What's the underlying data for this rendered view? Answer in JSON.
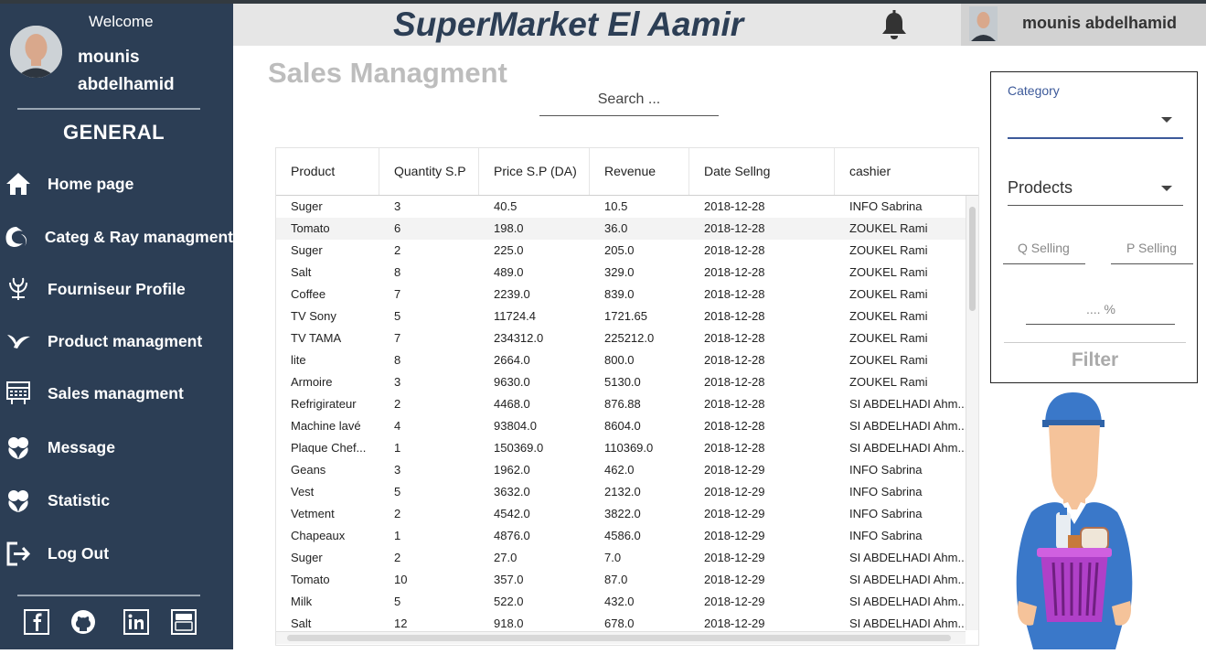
{
  "sidebar": {
    "welcome": "Welcome",
    "user_name": "mounis abdelhamid",
    "section": "GENERAL",
    "nav": [
      {
        "label": "Home page",
        "icon": "home-icon"
      },
      {
        "label": "Categ & Ray managment",
        "icon": "categ-icon"
      },
      {
        "label": "Fourniseur Profile",
        "icon": "fournisseur-icon"
      },
      {
        "label": "Product managment",
        "icon": "product-icon"
      },
      {
        "label": "Sales managment",
        "icon": "sales-icon"
      },
      {
        "label": "Message",
        "icon": "message-icon"
      },
      {
        "label": "Statistic",
        "icon": "statistic-icon"
      },
      {
        "label": "Log Out",
        "icon": "logout-icon"
      }
    ],
    "social": [
      "facebook-icon",
      "github-icon",
      "linkedin-icon",
      "youtube-icon"
    ]
  },
  "header": {
    "app_title": "SuperMarket El Aamir",
    "user_name": "mounis  abdelhamid"
  },
  "main": {
    "page_title": "Sales Managment",
    "search_placeholder": "Search ..."
  },
  "table": {
    "columns": [
      "Product",
      "Quantity S.P",
      "Price S.P (DA)",
      "Revenue",
      "Date Sellng",
      "cashier"
    ],
    "rows": [
      [
        "Suger",
        "3",
        "40.5",
        "10.5",
        "2018-12-28",
        "INFO Sabrina"
      ],
      [
        "Tomato",
        "6",
        "198.0",
        "36.0",
        "2018-12-28",
        "ZOUKEL Rami"
      ],
      [
        "Suger",
        "2",
        "225.0",
        "205.0",
        "2018-12-28",
        "ZOUKEL Rami"
      ],
      [
        "Salt",
        "8",
        "489.0",
        "329.0",
        "2018-12-28",
        "ZOUKEL Rami"
      ],
      [
        "Coffee",
        "7",
        "2239.0",
        "839.0",
        "2018-12-28",
        "ZOUKEL Rami"
      ],
      [
        "TV Sony",
        "5",
        "11724.4",
        "1721.65",
        "2018-12-28",
        "ZOUKEL Rami"
      ],
      [
        "TV TAMA",
        "7",
        "234312.0",
        "225212.0",
        "2018-12-28",
        "ZOUKEL Rami"
      ],
      [
        "lite",
        "8",
        "2664.0",
        "800.0",
        "2018-12-28",
        "ZOUKEL Rami"
      ],
      [
        "Armoire",
        "3",
        "9630.0",
        "5130.0",
        "2018-12-28",
        "ZOUKEL Rami"
      ],
      [
        "Refrigirateur",
        "2",
        "4468.0",
        "876.88",
        "2018-12-28",
        "SI ABDELHADI Ahm..."
      ],
      [
        "Machine lavé",
        "4",
        "93804.0",
        "8604.0",
        "2018-12-28",
        "SI ABDELHADI Ahm..."
      ],
      [
        "Plaque Chef...",
        "1",
        "150369.0",
        "110369.0",
        "2018-12-28",
        "SI ABDELHADI Ahm..."
      ],
      [
        "Geans",
        "3",
        "1962.0",
        "462.0",
        "2018-12-29",
        "INFO Sabrina"
      ],
      [
        "Vest",
        "5",
        "3632.0",
        "2132.0",
        "2018-12-29",
        "INFO Sabrina"
      ],
      [
        "Vetment",
        "2",
        "4542.0",
        "3822.0",
        "2018-12-29",
        "INFO Sabrina"
      ],
      [
        "Chapeaux",
        "1",
        "4876.0",
        "4586.0",
        "2018-12-29",
        "INFO Sabrina"
      ],
      [
        "Suger",
        "2",
        "27.0",
        "7.0",
        "2018-12-29",
        "SI ABDELHADI Ahm..."
      ],
      [
        "Tomato",
        "10",
        "357.0",
        "87.0",
        "2018-12-29",
        "SI ABDELHADI Ahm..."
      ],
      [
        "Milk",
        "5",
        "522.0",
        "432.0",
        "2018-12-29",
        "SI ABDELHADI Ahm..."
      ],
      [
        "Salt",
        "12",
        "918.0",
        "678.0",
        "2018-12-29",
        "SI ABDELHADI Ahm..."
      ]
    ],
    "selected_row": 1
  },
  "filter": {
    "category_label": "Category",
    "product_label": "Prodects",
    "q_selling": "Q Selling",
    "p_selling": "P Selling",
    "percent": ".... %",
    "button": "Filter"
  },
  "colors": {
    "sidebar_bg": "#2c3e55",
    "accent_blue": "#3d5a9a",
    "header_bg": "#e6e6e6"
  }
}
